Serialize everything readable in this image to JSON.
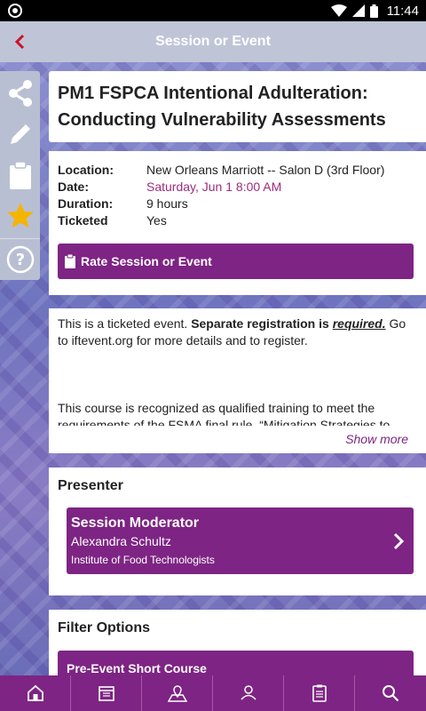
{
  "status_bar": {
    "time": "11:44"
  },
  "app_bar": {
    "title": "Session or Event"
  },
  "session": {
    "title": "PM1 FSPCA Intentional Adulteration: Conducting Vulnerability Assessments",
    "details": [
      {
        "label": "Location:",
        "value": "New Orleans Marriott -- Salon D (3rd Floor)"
      },
      {
        "label": "Date:",
        "value": "Saturday, Jun 1 8:00 AM"
      },
      {
        "label": "Duration:",
        "value": "9 hours"
      },
      {
        "label": "Ticketed",
        "value": "Yes"
      }
    ],
    "rate_label": "Rate Session or Event"
  },
  "description": {
    "p1_start": "This is a ticketed event. ",
    "p1_bold": "Separate registration is ",
    "p1_required": "required.",
    "p1_end": " Go to iftevent.org for more details and to register.",
    "p2": "This course is recognized as qualified training to meet the requirements of the FSMA final rule, “Mitigation Strategies to",
    "show_more": "Show more"
  },
  "presenter": {
    "section_title": "Presenter",
    "role": "Session Moderator",
    "name": "Alexandra Schultz",
    "org": "Institute of Food Technologists"
  },
  "filter": {
    "section_title": "Filter Options",
    "first_option": "Pre-Event Short Course"
  },
  "sidebar_icons": [
    "share-icon",
    "pencil-icon",
    "clipboard-icon",
    "star-icon",
    "help-icon"
  ],
  "bottom_nav_icons": [
    "home-icon",
    "schedule-icon",
    "map-icon",
    "people-icon",
    "badge-icon",
    "search-icon"
  ],
  "colors": {
    "accent": "#7e2484",
    "date": "#9c2c7e",
    "back_arrow": "#d0102b",
    "star": "#f5b400"
  }
}
